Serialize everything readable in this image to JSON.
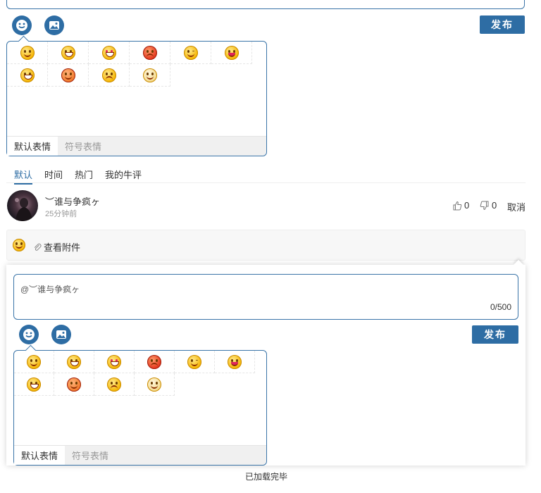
{
  "composer": {
    "publish_label": "发布",
    "emoji_icon": "smile-icon",
    "image_icon": "image-icon",
    "panel_tabs": [
      "默认表情",
      "符号表情"
    ]
  },
  "emojis": [
    {
      "name": "dizzy-face-icon"
    },
    {
      "name": "crying-face-icon"
    },
    {
      "name": "heart-eyes-face-icon"
    },
    {
      "name": "angry-face-icon"
    },
    {
      "name": "wink-face-icon"
    },
    {
      "name": "tongue-face-icon"
    },
    {
      "name": "grin-face-icon"
    },
    {
      "name": "kiss-face-icon"
    },
    {
      "name": "sad-face-icon"
    },
    {
      "name": "shocked-face-icon"
    }
  ],
  "sort_tabs": [
    "默认",
    "时间",
    "热门",
    "我的牛评"
  ],
  "comment": {
    "username": "︶谁与争疯ヶ",
    "time": "25分钟前",
    "likes": "0",
    "dislikes": "0",
    "cancel_label": "取消",
    "attachment_label": "查看附件"
  },
  "reply": {
    "input_value": "@︶谁与争疯ヶ",
    "counter": "0/500",
    "publish_label": "发布",
    "panel_tabs": [
      "默认表情",
      "符号表情"
    ]
  },
  "footer": {
    "status": "已加载完毕"
  },
  "colors": {
    "accent": "#2e6da4"
  }
}
